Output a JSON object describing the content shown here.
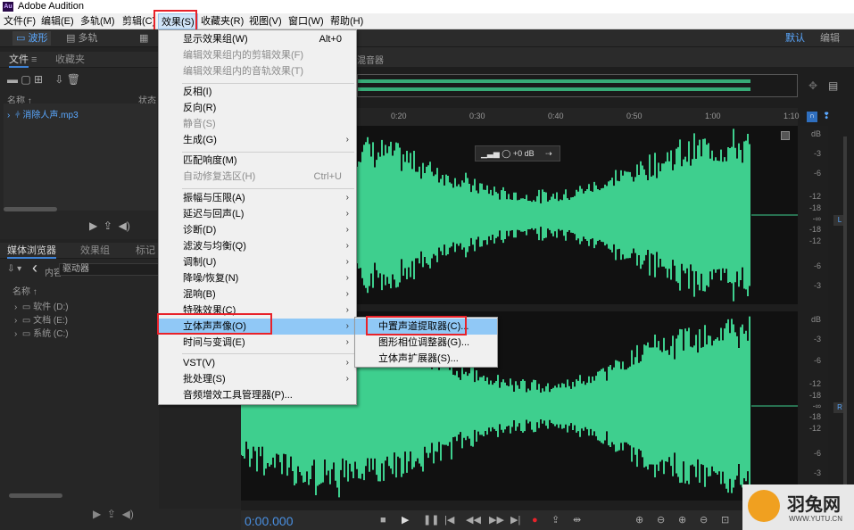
{
  "app": {
    "title": "Adobe Audition",
    "logo_text": "Au"
  },
  "menubar": [
    "文件(F)",
    "编辑(E)",
    "多轨(M)",
    "剪辑(C)",
    "效果(S)",
    "收藏夹(R)",
    "视图(V)",
    "窗口(W)",
    "帮助(H)"
  ],
  "toolbar": {
    "waveform": "波形",
    "multitrack": "多轨",
    "workspace": "默认",
    "edit": "编辑"
  },
  "files_panel": {
    "tab_files": "文件",
    "tab_favorites": "收藏夹",
    "col_name": "名称 ↑",
    "col_status": "状态",
    "file": "消除人声.mp3"
  },
  "media_panel": {
    "tab_media": "媒体浏览器",
    "tab_effects": "效果组",
    "tab_marks": "标记",
    "content_label": "内容:",
    "content_value": "驱动器",
    "col_name": "名称 ↑",
    "drives": [
      "软件 (D:)",
      "文档 (E:)",
      "系统 (C:)"
    ]
  },
  "editor": {
    "mixer_label": "混音器",
    "gain": "+0 dB",
    "timecode": "0:00.000",
    "ruler": [
      "0:20",
      "0:30",
      "0:40",
      "0:50",
      "1:00",
      "1:10"
    ],
    "db_top": [
      "dB",
      "-3",
      "-6",
      "-12",
      "-18",
      "-∞",
      "-18",
      "-12",
      "-6",
      "-3"
    ],
    "db_bottom": [
      "dB",
      "-3",
      "-6",
      "-12",
      "-18",
      "-∞",
      "-18",
      "-12",
      "-6",
      "-3"
    ],
    "ch_left": "L",
    "ch_right": "R",
    "wave_color": "#3ecf8e"
  },
  "effects_menu": [
    {
      "label": "显示效果组(W)",
      "shortcut": "Alt+0"
    },
    {
      "label": "编辑效果组内的剪辑效果(F)",
      "disabled": true
    },
    {
      "label": "编辑效果组内的音轨效果(T)",
      "disabled": true
    },
    {
      "label": "反相(I)"
    },
    {
      "label": "反向(R)"
    },
    {
      "label": "静音(S)",
      "disabled": true
    },
    {
      "label": "生成(G)",
      "submenu": true
    },
    {
      "label": "匹配响度(M)"
    },
    {
      "label": "自动修复选区(H)",
      "shortcut": "Ctrl+U",
      "disabled": true
    },
    {
      "label": "振幅与压限(A)",
      "submenu": true
    },
    {
      "label": "延迟与回声(L)",
      "submenu": true
    },
    {
      "label": "诊断(D)",
      "submenu": true
    },
    {
      "label": "滤波与均衡(Q)",
      "submenu": true
    },
    {
      "label": "调制(U)",
      "submenu": true
    },
    {
      "label": "降噪/恢复(N)",
      "submenu": true
    },
    {
      "label": "混响(B)",
      "submenu": true
    },
    {
      "label": "特殊效果(C)",
      "submenu": true
    },
    {
      "label": "立体声声像(O)",
      "submenu": true,
      "highlight": true
    },
    {
      "label": "时间与变调(E)",
      "submenu": true
    },
    {
      "label": "VST(V)",
      "submenu": true
    },
    {
      "label": "批处理(S)",
      "submenu": true
    },
    {
      "label": "音频增效工具管理器(P)..."
    }
  ],
  "stereo_submenu": [
    "中置声道提取器(C)...",
    "图形相位调整器(G)...",
    "立体声扩展器(S)..."
  ],
  "watermark": {
    "text": "羽兔网",
    "url": "WWW.YUTU.CN"
  }
}
